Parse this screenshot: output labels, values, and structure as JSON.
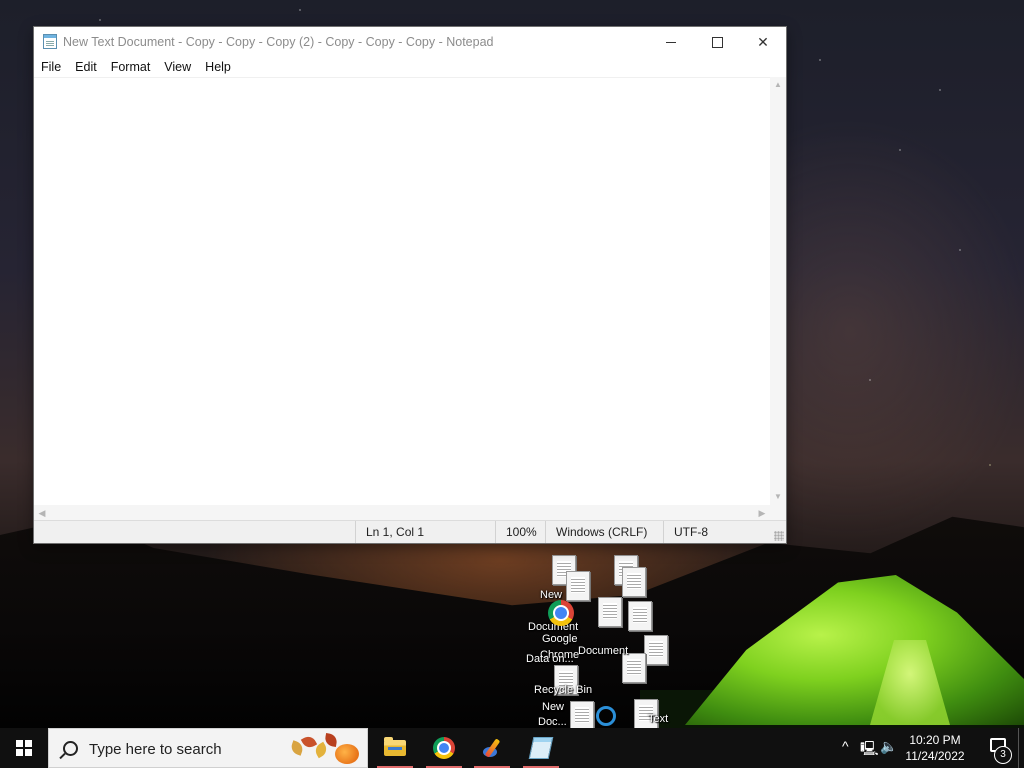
{
  "window": {
    "title": "New Text Document - Copy - Copy - Copy (2) - Copy - Copy - Copy - Notepad",
    "menu": [
      "File",
      "Edit",
      "Format",
      "View",
      "Help"
    ],
    "status": {
      "position": "Ln 1, Col 1",
      "zoom": "100%",
      "line_ending": "Windows (CRLF)",
      "encoding": "UTF-8"
    }
  },
  "desktop": {
    "labels": [
      "New",
      "Document",
      "Google",
      "Chrome",
      "Data on...",
      "Recycle Bin",
      "New",
      "Doc...",
      "Document",
      "Text"
    ]
  },
  "taskbar": {
    "search_placeholder": "Type here to search",
    "apps": [
      "file-explorer",
      "google-chrome",
      "paint",
      "notepad"
    ],
    "clock_time": "10:20 PM",
    "clock_date": "11/24/2022",
    "notification_count": "3"
  },
  "colors": {
    "taskbar": "#101010",
    "accent_underline": "#e06c6c",
    "tent_green": "#7fd11f"
  }
}
